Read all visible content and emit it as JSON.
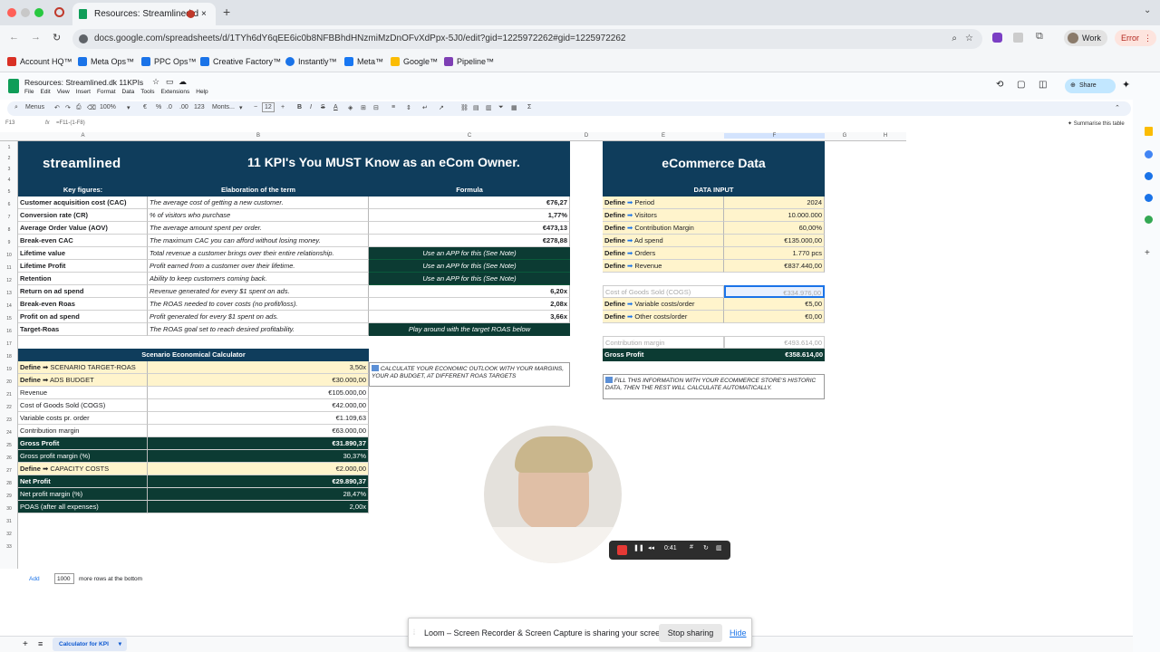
{
  "browser": {
    "tab_title": "Resources: Streamlined.d",
    "url": "docs.google.com/spreadsheets/d/1TYh6dY6qEE6ic0b8NFBBhdHNzmiMzDnOFvXdPpx-5J0/edit?gid=1225972262#gid=1225972262",
    "profile": "Work",
    "error": "Error"
  },
  "bookmarks": [
    {
      "label": "Account HQ™",
      "color": "#d93025"
    },
    {
      "label": "Meta Ops™",
      "color": "#1a73e8"
    },
    {
      "label": "PPC Ops™",
      "color": "#1a73e8"
    },
    {
      "label": "Creative Factory™",
      "color": "#1a73e8"
    },
    {
      "label": "Instantly™",
      "color": "#1a73e8"
    },
    {
      "label": "Meta™",
      "color": "#1877f2"
    },
    {
      "label": "Google™",
      "color": "#fbbc04"
    },
    {
      "label": "Pipeline™",
      "color": "#7e3fb4"
    }
  ],
  "doc": {
    "title": "Resources: Streamlined.dk 11KPIs",
    "menu": [
      "File",
      "Edit",
      "View",
      "Insert",
      "Format",
      "Data",
      "Tools",
      "Extensions",
      "Help"
    ],
    "share": "Share"
  },
  "toolbar": {
    "menus": "Menus",
    "zoom": "100%",
    "format_items": [
      "€",
      "%",
      ".0",
      ".00",
      "123"
    ],
    "font": "Monts...",
    "font_size": "12"
  },
  "formula_bar": {
    "cell": "F13",
    "formula": "=F11-(1-F8)",
    "summarise": "Summarise this table"
  },
  "columns": [
    "A",
    "B",
    "C",
    "D",
    "E",
    "F",
    "G",
    "H"
  ],
  "banner": {
    "logo": "streamlined",
    "title": "11 KPI's You MUST Know as an eCom Owner.",
    "ecom_title": "eCommerce Data"
  },
  "kpi_headers": [
    "Key figures:",
    "Elaboration of the term",
    "Formula"
  ],
  "kpi_rows": [
    [
      "Customer acquisition cost (CAC)",
      "The average cost of getting a new customer.",
      "€76,27"
    ],
    [
      "Conversion rate (CR)",
      "% of visitors who purchase",
      "1,77%"
    ],
    [
      "Average Order Value (AOV)",
      "The average amount spent per order.",
      "€473,13"
    ],
    [
      "Break-even CAC",
      "The maximum CAC you can afford without losing money.",
      "€278,88"
    ],
    [
      "Lifetime value",
      "Total revenue a customer brings over their entire relationship.",
      "Use an APP for this (See Note)"
    ],
    [
      "Lifetime Profit",
      "Profit earned from a customer over their lifetime.",
      "Use an APP for this (See Note)"
    ],
    [
      "Retention",
      "Ability to keep customers coming back.",
      "Use an APP for this (See Note)"
    ],
    [
      "Return on ad spend",
      "Revenue generated for every $1 spent on ads.",
      "6,20x"
    ],
    [
      "Break-even Roas",
      "The ROAS needed to cover costs (no profit/loss).",
      "2,08x"
    ],
    [
      "Profit on ad spend",
      "Profit generated for every $1 spent on ads.",
      "3,66x"
    ],
    [
      "Target-Roas",
      "The ROAS goal set to reach desired profitability.",
      "Play around with the target ROAS below"
    ]
  ],
  "data_input": {
    "header": "DATA INPUT",
    "define": "Define",
    "rows": [
      {
        "label": "Period",
        "value": "2024"
      },
      {
        "label": "Visitors",
        "value": "10.000.000"
      },
      {
        "label": "Contribution Margin",
        "value": "60,00%"
      },
      {
        "label": "Ad spend",
        "value": "€135.000,00"
      },
      {
        "label": "Orders",
        "value": "1.770 pcs"
      },
      {
        "label": "Revenue",
        "value": "€837.440,00"
      }
    ],
    "cogs": {
      "label": "Cost of Goods Sold (COGS)",
      "value": "€334.976,00"
    },
    "var_costs": {
      "label": "Variable costs/order",
      "value": "€5,00"
    },
    "other_costs": {
      "label": "Other costs/order",
      "value": "€0,00"
    },
    "contribution": {
      "label": "Contribution margin",
      "value": "€493.614,00"
    },
    "gross_profit": {
      "label": "Gross Profit",
      "value": "€358.614,00"
    },
    "note": "FILL THIS INFORMATION WITH YOUR ECOMMERCE STORE'S HISTORIC DATA, THEN THE REST WILL CALCULATE AUTOMATICALLY."
  },
  "scenario": {
    "title": "Scenario Economical Calculator",
    "note": "CALCULATE YOUR ECONOMIC OUTLOOK WITH YOUR MARGINS, YOUR AD BUDGET, AT DIFFERENT ROAS TARGETS",
    "rows": [
      [
        "Define ➡ SCENARIO TARGET-ROAS",
        "3,50x"
      ],
      [
        "Define ➡ ADS BUDGET",
        "€30.000,00"
      ],
      [
        "Revenue",
        "€105.000,00"
      ],
      [
        "Cost of Goods Sold (COGS)",
        "€42.000,00"
      ],
      [
        "Variable costs pr. order",
        "€1.109,63"
      ],
      [
        "Contribution margin",
        "€63.000,00"
      ],
      [
        "Gross Profit",
        "€31.890,37"
      ],
      [
        "Gross profit margin (%)",
        "30,37%"
      ],
      [
        "Define ➡ CAPACITY COSTS",
        "€2.000,00"
      ],
      [
        "Net Profit",
        "€29.890,37"
      ],
      [
        "Net profit margin (%)",
        "28,47%"
      ],
      [
        "POAS (after all expenses)",
        "2,00x"
      ]
    ]
  },
  "bottom": {
    "add": "Add",
    "rows": "1000",
    "rows_text": "more rows at the bottom",
    "sheet_tab": "Calculator for KPI"
  },
  "recorder": {
    "time": "0:41"
  },
  "share_banner": {
    "text": "Loom – Screen Recorder & Screen Capture is sharing your screen.",
    "stop": "Stop sharing",
    "hide": "Hide"
  }
}
